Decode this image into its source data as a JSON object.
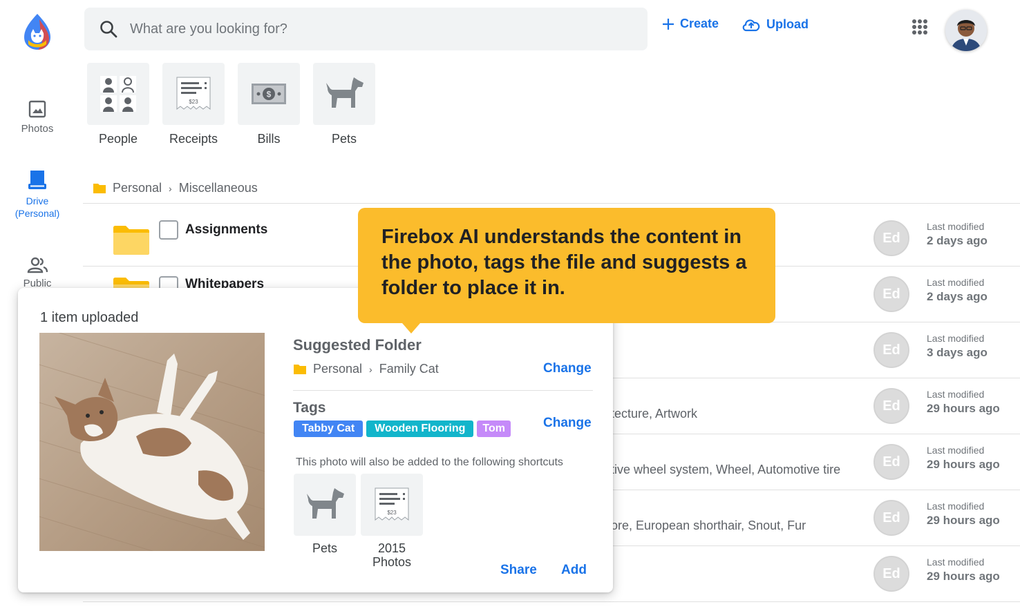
{
  "search": {
    "placeholder": "What are you looking for?"
  },
  "toolbar": {
    "create_label": "Create",
    "upload_label": "Upload"
  },
  "sidebar": {
    "items": [
      {
        "label": "Photos"
      },
      {
        "label": "Drive\n(Personal)"
      },
      {
        "label": "Public"
      }
    ]
  },
  "categories": [
    {
      "label": "People"
    },
    {
      "label": "Receipts"
    },
    {
      "label": "Bills"
    },
    {
      "label": "Pets"
    }
  ],
  "breadcrumb": {
    "root": "Personal",
    "current": "Miscellaneous"
  },
  "files": [
    {
      "name": "Assignments",
      "tags": "",
      "owner": "Ed",
      "modified_label": "Last modified",
      "modified": "2 days ago"
    },
    {
      "name": "Whitepapers",
      "tags": "",
      "owner": "Ed",
      "modified_label": "Last modified",
      "modified": "2 days ago"
    },
    {
      "name": "",
      "tags": "",
      "owner": "Ed",
      "modified_label": "Last modified",
      "modified": "3 days ago"
    },
    {
      "name": "",
      "tags": "tecture, Artwork",
      "owner": "Ed",
      "modified_label": "Last modified",
      "modified": "29 hours ago"
    },
    {
      "name": "",
      "tags": "tive wheel system, Wheel, Automotive tire",
      "owner": "Ed",
      "modified_label": "Last modified",
      "modified": "29 hours ago"
    },
    {
      "name": "",
      "tags": "ore, European shorthair, Snout, Fur",
      "owner": "Ed",
      "modified_label": "Last modified",
      "modified": "29 hours ago"
    },
    {
      "name": "",
      "tags": "",
      "owner": "Ed",
      "modified_label": "Last modified",
      "modified": "29 hours ago"
    }
  ],
  "upload_panel": {
    "title": "1 item uploaded",
    "suggested_title": "Suggested Folder",
    "suggested_root": "Personal",
    "suggested_folder": "Family Cat",
    "change_label": "Change",
    "tags_title": "Tags",
    "tags": [
      {
        "label": "Tabby Cat",
        "color": "#4285f4"
      },
      {
        "label": "Wooden Flooring",
        "color": "#12b5cb"
      },
      {
        "label": "Tom",
        "color": "#c58af9"
      }
    ],
    "shortcuts_note": "This photo will also be added to the following shortcuts",
    "shortcuts": [
      {
        "label": "Pets"
      },
      {
        "label": "2015\nPhotos"
      }
    ],
    "share_label": "Share",
    "add_label": "Add"
  },
  "callout": {
    "text": "Firebox AI understands the content in the photo, tags the file and suggests a folder to place it in."
  },
  "colors": {
    "accent": "#1a73e8",
    "callout": "#fbbc2c",
    "folder": "#fbbc04"
  }
}
